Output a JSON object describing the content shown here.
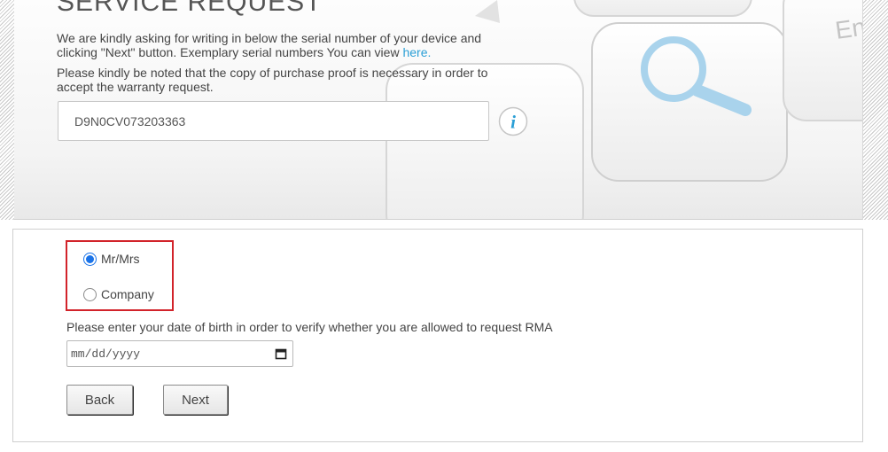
{
  "hero": {
    "title": "SERVICE REQUEST",
    "intro_text": "We are kindly asking for writing in below the serial number of your device and clicking \"Next\" button. Exemplary serial numbers You can view ",
    "intro_link": "here.",
    "note_text": "Please kindly be noted that the copy of purchase proof is necessary in order to accept the warranty request.",
    "keyboard_key_text": "En",
    "serial_number": "D9N0CV073203363",
    "info_icon_glyph": "i"
  },
  "form": {
    "customer_type": {
      "options": [
        {
          "label": "Mr/Mrs",
          "checked": true
        },
        {
          "label": "Company",
          "checked": false
        }
      ]
    },
    "dob_label": "Please enter your date of birth in order to verify whether you are allowed to request RMA",
    "dob_placeholder": "mm/dd/yyyy",
    "back_label": "Back",
    "next_label": "Next"
  },
  "colors": {
    "link": "#2a9fd6",
    "highlight_border": "#d2232a",
    "radio_selected": "#1a73e8",
    "magnifier": "#a9d3ec"
  },
  "icons": [
    "magnifier-icon",
    "info-icon",
    "calendar-icon"
  ]
}
